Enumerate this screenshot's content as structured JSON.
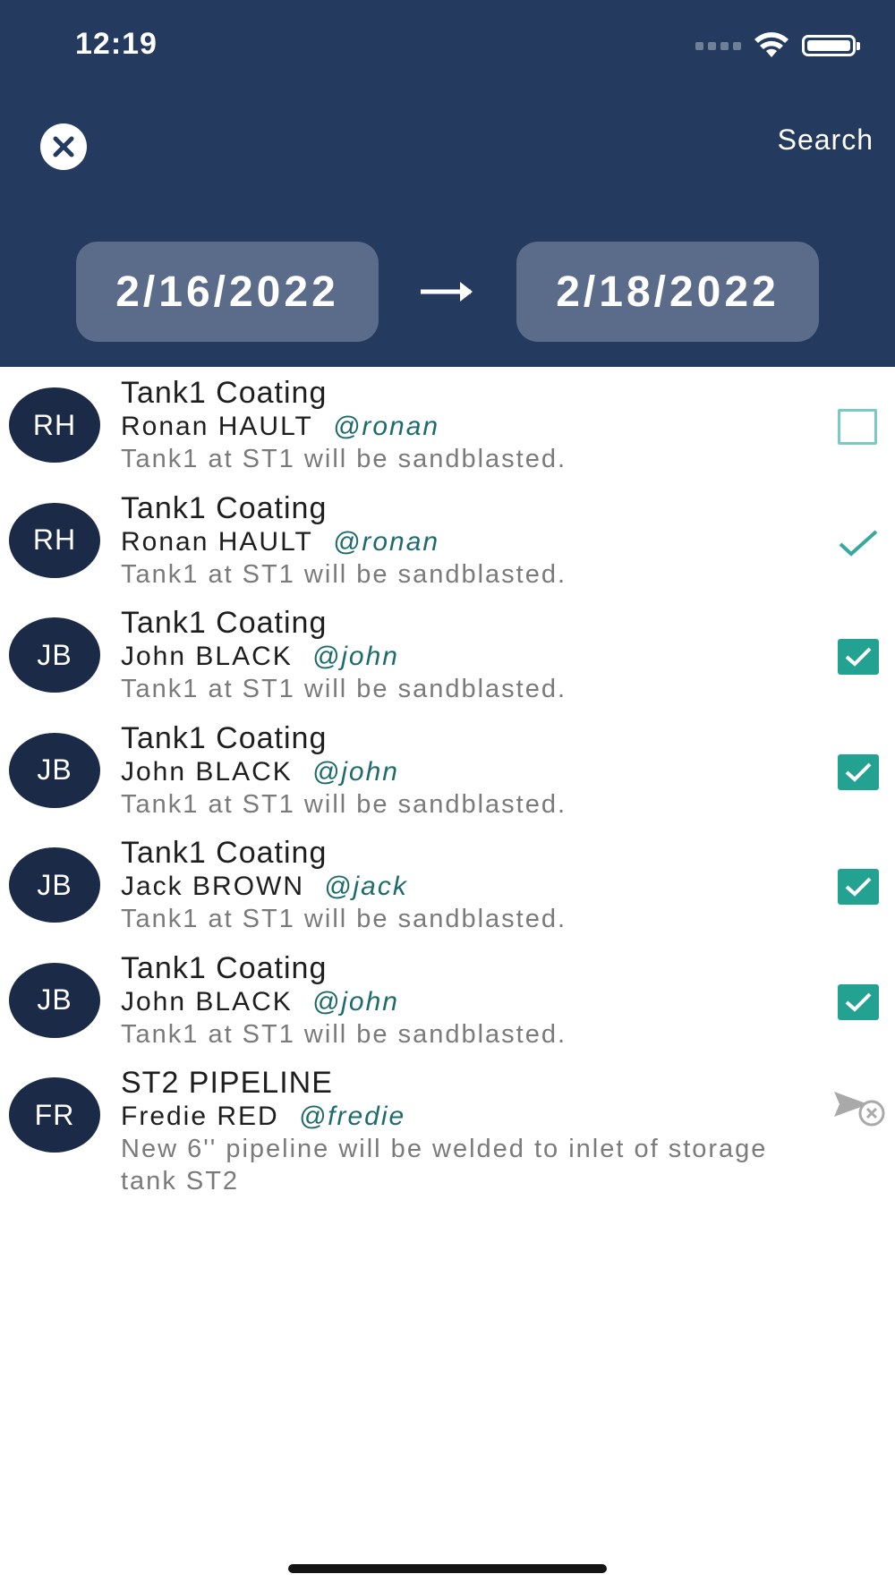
{
  "status_bar": {
    "time": "12:19"
  },
  "header": {
    "close_icon": "close-icon",
    "search_label": "Search",
    "date_from": "2/16/2022",
    "date_to": "2/18/2022",
    "arrow_icon": "arrow-right-icon"
  },
  "colors": {
    "header_bg": "#243a5e",
    "date_box_bg": "#5a6c89",
    "avatar_bg": "#1b2b47",
    "accent_teal": "#24a291",
    "handle_color": "#1e6b6e"
  },
  "items": [
    {
      "initials": "RH",
      "title": "Tank1 Coating",
      "name": "Ronan HAULT",
      "handle": "@ronan",
      "description": "Tank1 at ST1 will be sandblasted.",
      "status": "unchecked"
    },
    {
      "initials": "RH",
      "title": "Tank1 Coating",
      "name": "Ronan HAULT",
      "handle": "@ronan",
      "description": "Tank1 at ST1 will be sandblasted.",
      "status": "check"
    },
    {
      "initials": "JB",
      "title": "Tank1 Coating",
      "name": "John BLACK",
      "handle": "@john",
      "description": "Tank1 at ST1 will be sandblasted.",
      "status": "checked"
    },
    {
      "initials": "JB",
      "title": "Tank1 Coating",
      "name": "John BLACK",
      "handle": "@john",
      "description": "Tank1 at ST1 will be sandblasted.",
      "status": "checked"
    },
    {
      "initials": "JB",
      "title": "Tank1 Coating",
      "name": "Jack BROWN",
      "handle": "@jack",
      "description": "Tank1 at ST1 will be sandblasted.",
      "status": "checked"
    },
    {
      "initials": "JB",
      "title": "Tank1 Coating",
      "name": "John BLACK",
      "handle": "@john",
      "description": "Tank1 at ST1 will be sandblasted.",
      "status": "checked"
    },
    {
      "initials": "FR",
      "title": "ST2 PIPELINE",
      "name": "Fredie RED",
      "handle": "@fredie",
      "description": "New 6'' pipeline will be welded to inlet of storage tank ST2",
      "status": "send-cancelled"
    }
  ]
}
